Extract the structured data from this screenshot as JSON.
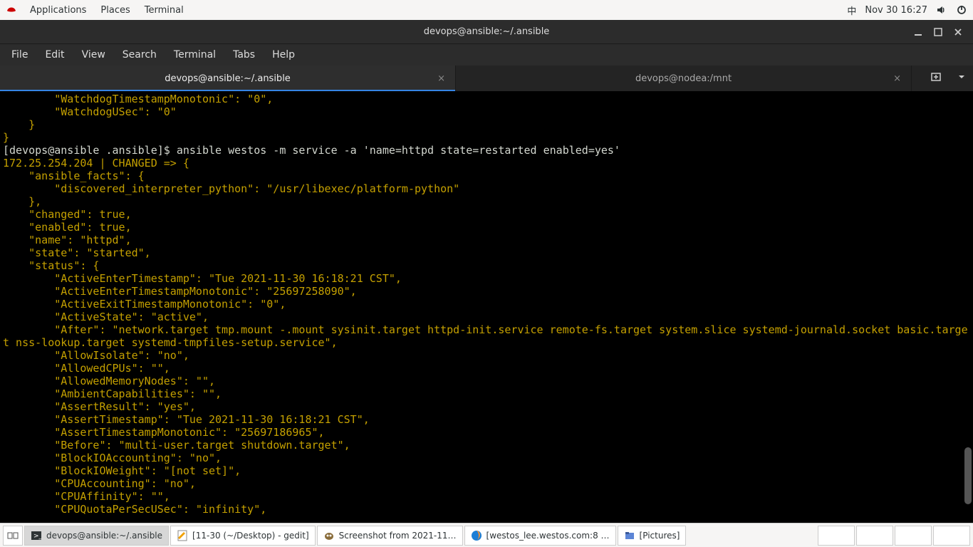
{
  "topbar": {
    "apps": "Applications",
    "places": "Places",
    "terminal": "Terminal",
    "ime": "中",
    "clock": "Nov 30  16:27"
  },
  "window": {
    "title": "devops@ansible:~/.ansible",
    "menus": {
      "file": "File",
      "edit": "Edit",
      "view": "View",
      "search": "Search",
      "terminal": "Terminal",
      "tabs": "Tabs",
      "help": "Help"
    },
    "tabs": [
      {
        "label": "devops@ansible:~/.ansible",
        "active": true
      },
      {
        "label": "devops@nodea:/mnt",
        "active": false
      }
    ]
  },
  "terminal": {
    "pre_lines": [
      "        \"WatchdogTimestampMonotonic\": \"0\",",
      "        \"WatchdogUSec\": \"0\"",
      "    }",
      "}"
    ],
    "prompt_user": "[devops@ansible .ansible]$ ",
    "prompt_cmd": "ansible westos -m service -a 'name=httpd state=restarted enabled=yes'",
    "out_lines": [
      "172.25.254.204 | CHANGED => {",
      "    \"ansible_facts\": {",
      "        \"discovered_interpreter_python\": \"/usr/libexec/platform-python\"",
      "    },",
      "    \"changed\": true,",
      "    \"enabled\": true,",
      "    \"name\": \"httpd\",",
      "    \"state\": \"started\",",
      "    \"status\": {",
      "        \"ActiveEnterTimestamp\": \"Tue 2021-11-30 16:18:21 CST\",",
      "        \"ActiveEnterTimestampMonotonic\": \"25697258090\",",
      "        \"ActiveExitTimestampMonotonic\": \"0\",",
      "        \"ActiveState\": \"active\",",
      "        \"After\": \"network.target tmp.mount -.mount sysinit.target httpd-init.service remote-fs.target system.slice systemd-journald.socket basic.target nss-lookup.target systemd-tmpfiles-setup.service\",",
      "        \"AllowIsolate\": \"no\",",
      "        \"AllowedCPUs\": \"\",",
      "        \"AllowedMemoryNodes\": \"\",",
      "        \"AmbientCapabilities\": \"\",",
      "        \"AssertResult\": \"yes\",",
      "        \"AssertTimestamp\": \"Tue 2021-11-30 16:18:21 CST\",",
      "        \"AssertTimestampMonotonic\": \"25697186965\",",
      "        \"Before\": \"multi-user.target shutdown.target\",",
      "        \"BlockIOAccounting\": \"no\",",
      "        \"BlockIOWeight\": \"[not set]\",",
      "        \"CPUAccounting\": \"no\",",
      "        \"CPUAffinity\": \"\",",
      "        \"CPUQuotaPerSecUSec\": \"infinity\","
    ]
  },
  "taskbar": {
    "items": [
      {
        "label": "devops@ansible:~/.ansible",
        "icon": "terminal",
        "active": true
      },
      {
        "label": "[11-30 (~/Desktop) - gedit]",
        "icon": "gedit",
        "active": false
      },
      {
        "label": "Screenshot from 2021-11…",
        "icon": "gimp",
        "active": false
      },
      {
        "label": "[westos_lee.westos.com:8 …",
        "icon": "firefox",
        "active": false
      },
      {
        "label": "[Pictures]",
        "icon": "files",
        "active": false
      }
    ]
  }
}
